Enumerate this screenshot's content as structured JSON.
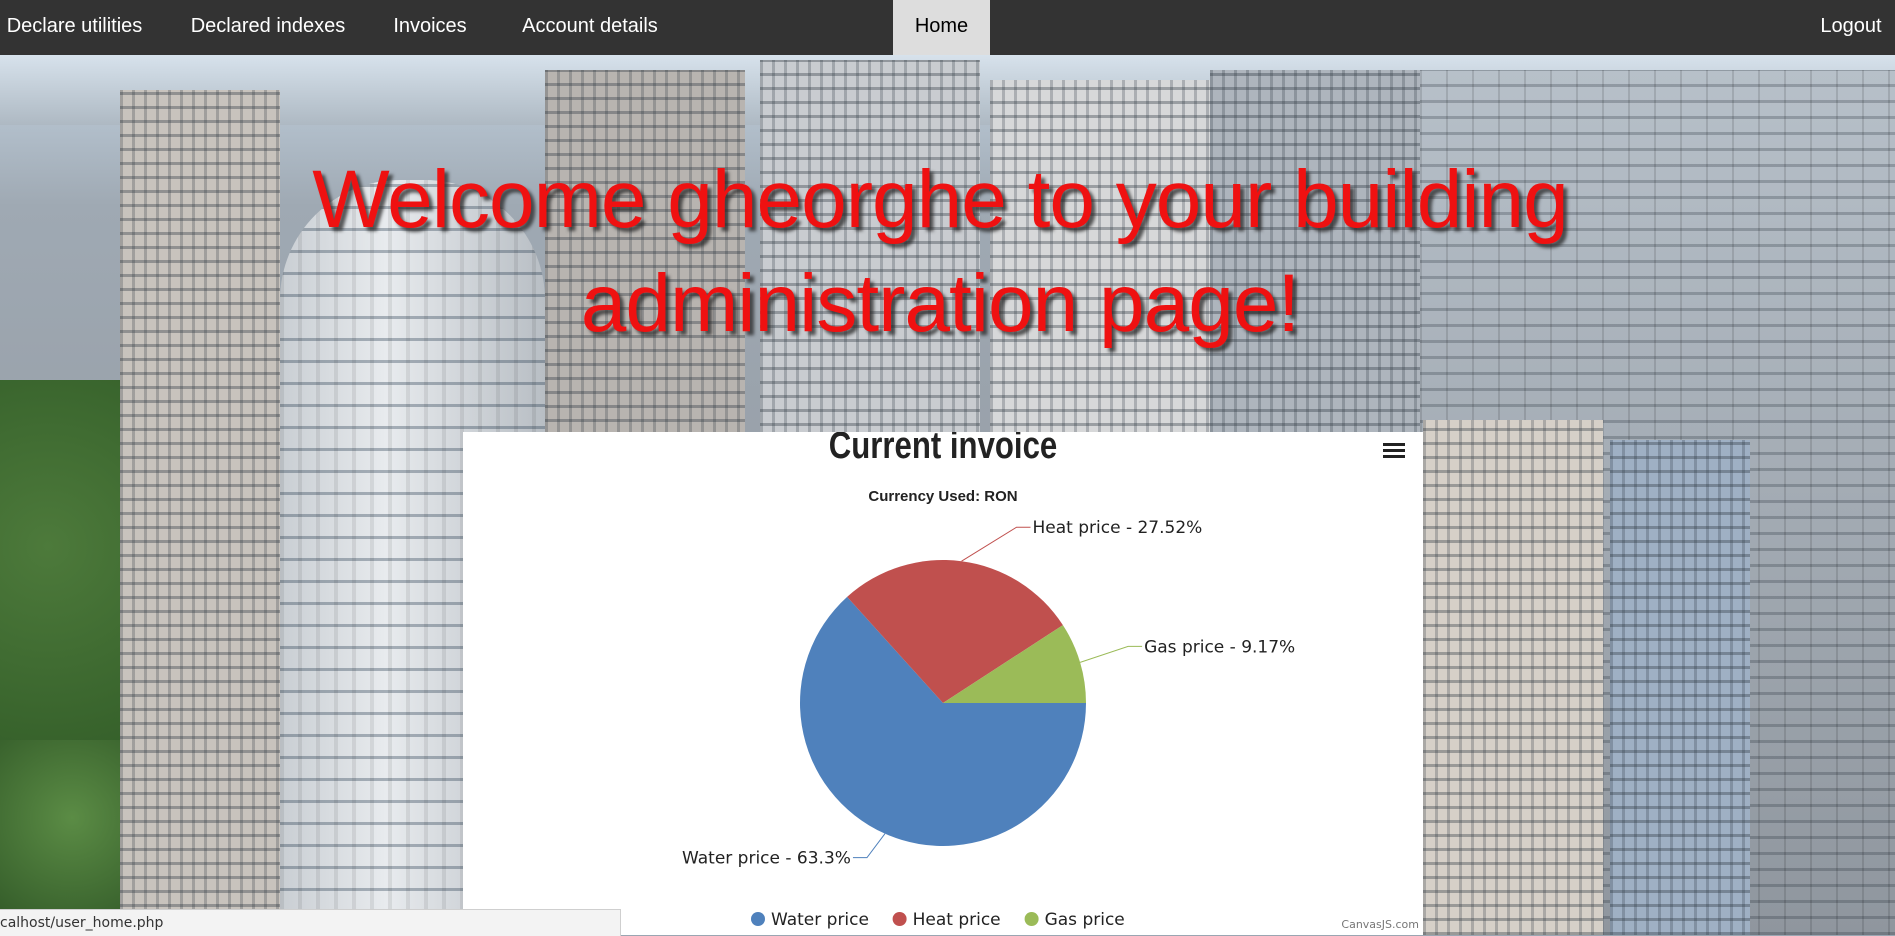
{
  "nav": {
    "items": [
      "Declare utilities",
      "Declared indexes",
      "Invoices",
      "Account details"
    ],
    "home": "Home",
    "logout": "Logout"
  },
  "welcome": {
    "line1": "Welcome gheorghe to your building",
    "line2": "administration page!"
  },
  "colors": {
    "nav_bg": "#333333",
    "heading": "#ef1111",
    "water": "#4f81bc",
    "heat": "#c0504e",
    "gas": "#9bbb58"
  },
  "chart_data": {
    "type": "pie",
    "title": "Current invoice",
    "subtitle": "Currency Used: RON",
    "slices": [
      {
        "name": "Water price",
        "percent": 63.3,
        "label": "Water price - 63.3%",
        "color": "#4f81bc"
      },
      {
        "name": "Heat price",
        "percent": 27.52,
        "label": "Heat price - 27.52%",
        "color": "#c0504e"
      },
      {
        "name": "Gas price",
        "percent": 9.17,
        "label": "Gas price - 9.17%",
        "color": "#9bbb58"
      }
    ],
    "legend": [
      "Water price",
      "Heat price",
      "Gas price"
    ],
    "legend_placement": "bottom",
    "credit": "CanvasJS.com"
  },
  "status": {
    "url": "calhost/user_home.php"
  },
  "icons": {
    "chart_menu": "hamburger-menu-icon"
  }
}
